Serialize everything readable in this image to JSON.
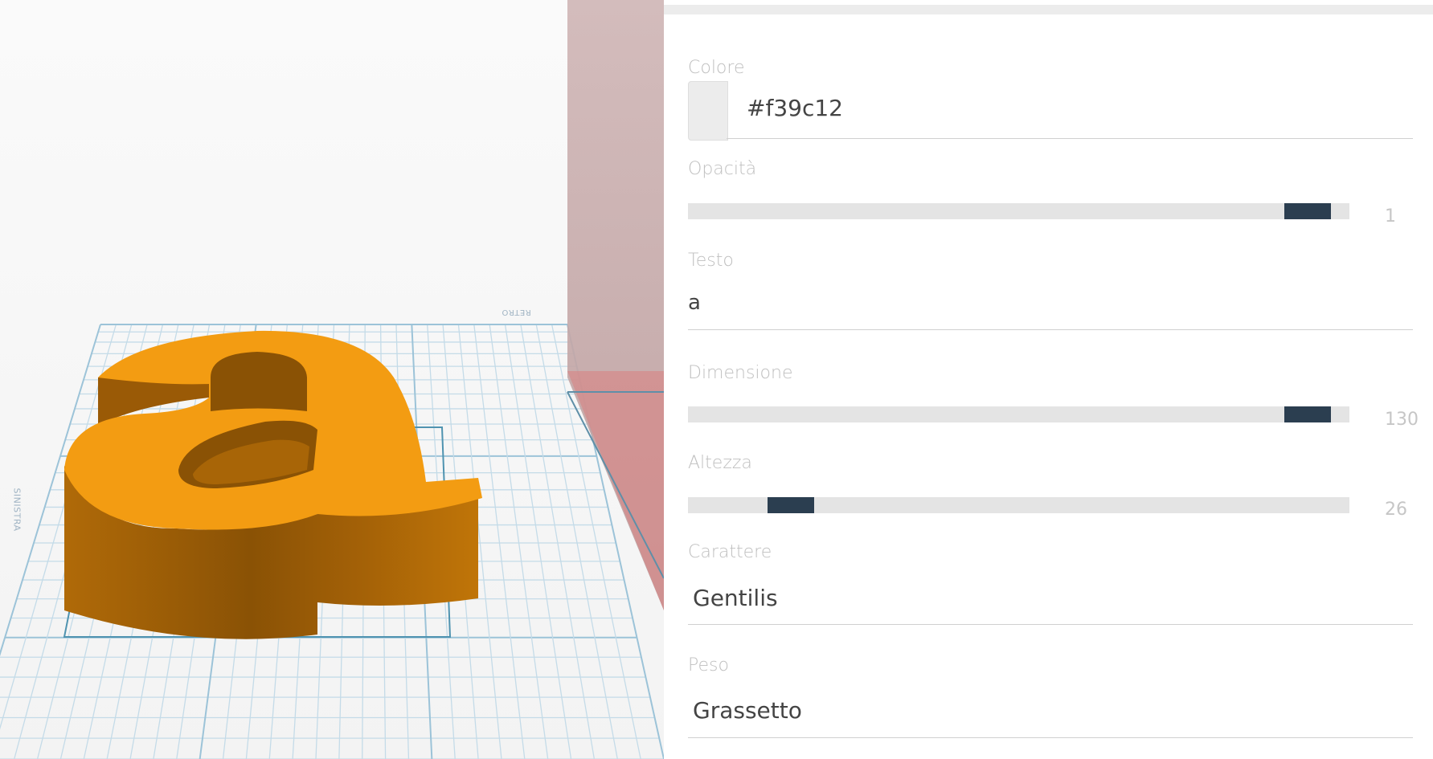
{
  "viewport": {
    "object_text": "a",
    "object_color": "#f39c12",
    "axis_left_label": "SINISTRA",
    "axis_back_label": "RETRO"
  },
  "properties": {
    "color": {
      "label": "Colore",
      "value": "#f39c12"
    },
    "opacity": {
      "label": "Opacità",
      "value": "1",
      "level": 0.97
    },
    "text": {
      "label": "Testo",
      "value": "a"
    },
    "size": {
      "label": "Dimensione",
      "value": "130",
      "level": 0.97
    },
    "height": {
      "label": "Altezza",
      "value": "26",
      "level": 0.13
    },
    "font": {
      "label": "Carattere",
      "value": "Gentilis"
    },
    "weight": {
      "label": "Peso",
      "value": "Grassetto"
    }
  },
  "colors": {
    "accent_thumb": "#2b3e50",
    "track": "#e4e4e4",
    "object": "#f39c12"
  }
}
